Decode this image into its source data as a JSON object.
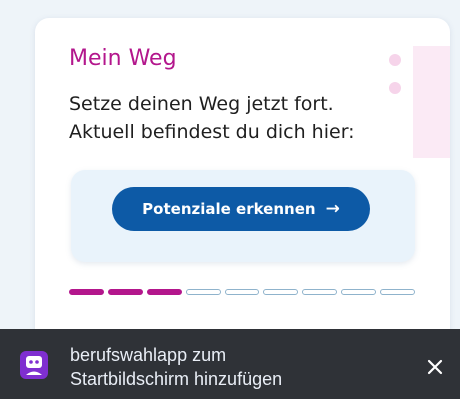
{
  "card": {
    "title": "Mein Weg",
    "text_line1": "Setze deinen Weg jetzt fort.",
    "text_line2": "Aktuell befindest du dich hier:",
    "button_label": "Potenziale erkennen",
    "button_icon": "arrow-right-icon",
    "progress": {
      "completed": 3,
      "total": 9
    }
  },
  "toast": {
    "icon": "app-icon",
    "text_line1": "berufswahlapp zum",
    "text_line2": "Startbildschirm hinzufügen",
    "close_icon": "close-icon"
  },
  "colors": {
    "accent": "#b3168c",
    "primary_button": "#0d5aa6",
    "toast_background": "#2f3237",
    "app_icon": "#7f2fd0"
  }
}
